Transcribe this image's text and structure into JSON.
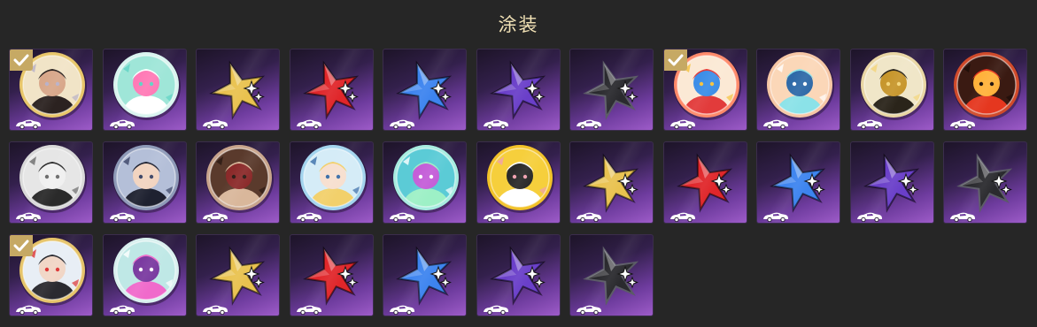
{
  "header": {
    "title": "涂装"
  },
  "colors": {
    "background": "#262626",
    "title": "#f2e2b6",
    "check_badge": "#c6a964",
    "tile_gradient_dark": "#1d1428",
    "tile_gradient_light": "#9d5bc8"
  },
  "items": [
    {
      "name": "avatar-character-tile",
      "icon": "character-portrait-badge",
      "equipped": true
    },
    {
      "name": "avatar-mint-wave-tile",
      "icon": "mint-glass-badge",
      "equipped": false
    },
    {
      "name": "star-gold-tile",
      "icon": "sparkle-star-icon",
      "color": "#e9c24f",
      "equipped": false
    },
    {
      "name": "star-red-tile",
      "icon": "sparkle-star-icon",
      "color": "#e0262a",
      "equipped": false
    },
    {
      "name": "star-blue-tile",
      "icon": "sparkle-star-icon",
      "color": "#3d84ef",
      "equipped": false
    },
    {
      "name": "star-purple-tile",
      "icon": "sparkle-star-icon",
      "color": "#6a3fc9",
      "equipped": false
    },
    {
      "name": "star-black-tile",
      "icon": "sparkle-star-icon",
      "color": "#2a2a2e",
      "equipped": false
    },
    {
      "name": "avatar-stickers-tile",
      "icon": "sticker-collage-badge",
      "equipped": true
    },
    {
      "name": "avatar-mecha-cat-tile",
      "icon": "mecha-cat-badge",
      "equipped": false
    },
    {
      "name": "avatar-gold-emblem-tile",
      "icon": "gold-emblem-badge",
      "equipped": false
    },
    {
      "name": "avatar-red-creature-tile",
      "icon": "red-creature-badge",
      "equipped": false
    },
    {
      "name": "avatar-masked-figure-tile",
      "icon": "masked-figure-badge",
      "equipped": false
    },
    {
      "name": "avatar-dark-hair-tile",
      "icon": "dark-hair-character-badge",
      "equipped": false
    },
    {
      "name": "avatar-group-tile",
      "icon": "group-portrait-badge",
      "equipped": false
    },
    {
      "name": "avatar-blonde-chibi-tile",
      "icon": "blonde-chibi-badge",
      "equipped": false
    },
    {
      "name": "avatar-aqua-swirl-tile",
      "icon": "aqua-swirl-badge",
      "equipped": false
    },
    {
      "name": "avatar-cow-tile",
      "icon": "cow-mascot-badge",
      "equipped": false
    },
    {
      "name": "star-gold-2-tile",
      "icon": "sparkle-star-icon",
      "color": "#e9c24f",
      "equipped": false
    },
    {
      "name": "star-red-2-tile",
      "icon": "sparkle-star-icon",
      "color": "#e0262a",
      "equipped": false
    },
    {
      "name": "star-blue-2-tile",
      "icon": "sparkle-star-icon",
      "color": "#3d84ef",
      "equipped": false
    },
    {
      "name": "star-purple-2-tile",
      "icon": "sparkle-star-icon",
      "color": "#6a3fc9",
      "equipped": false
    },
    {
      "name": "star-black-2-tile",
      "icon": "sparkle-star-icon",
      "color": "#2a2a2e",
      "equipped": false
    },
    {
      "name": "avatar-character-2-tile",
      "icon": "character-duo-badge",
      "equipped": true
    },
    {
      "name": "avatar-pink-cat-tile",
      "icon": "pink-cat-badge",
      "equipped": false
    },
    {
      "name": "star-gold-3-tile",
      "icon": "sparkle-star-icon",
      "color": "#e9c24f",
      "equipped": false
    },
    {
      "name": "star-red-3-tile",
      "icon": "sparkle-star-icon",
      "color": "#e0262a",
      "equipped": false
    },
    {
      "name": "star-blue-3-tile",
      "icon": "sparkle-star-icon",
      "color": "#3d84ef",
      "equipped": false
    },
    {
      "name": "star-purple-3-tile",
      "icon": "sparkle-star-icon",
      "color": "#6a3fc9",
      "equipped": false
    },
    {
      "name": "star-black-3-tile",
      "icon": "sparkle-star-icon",
      "color": "#2a2a2e",
      "equipped": false
    }
  ]
}
